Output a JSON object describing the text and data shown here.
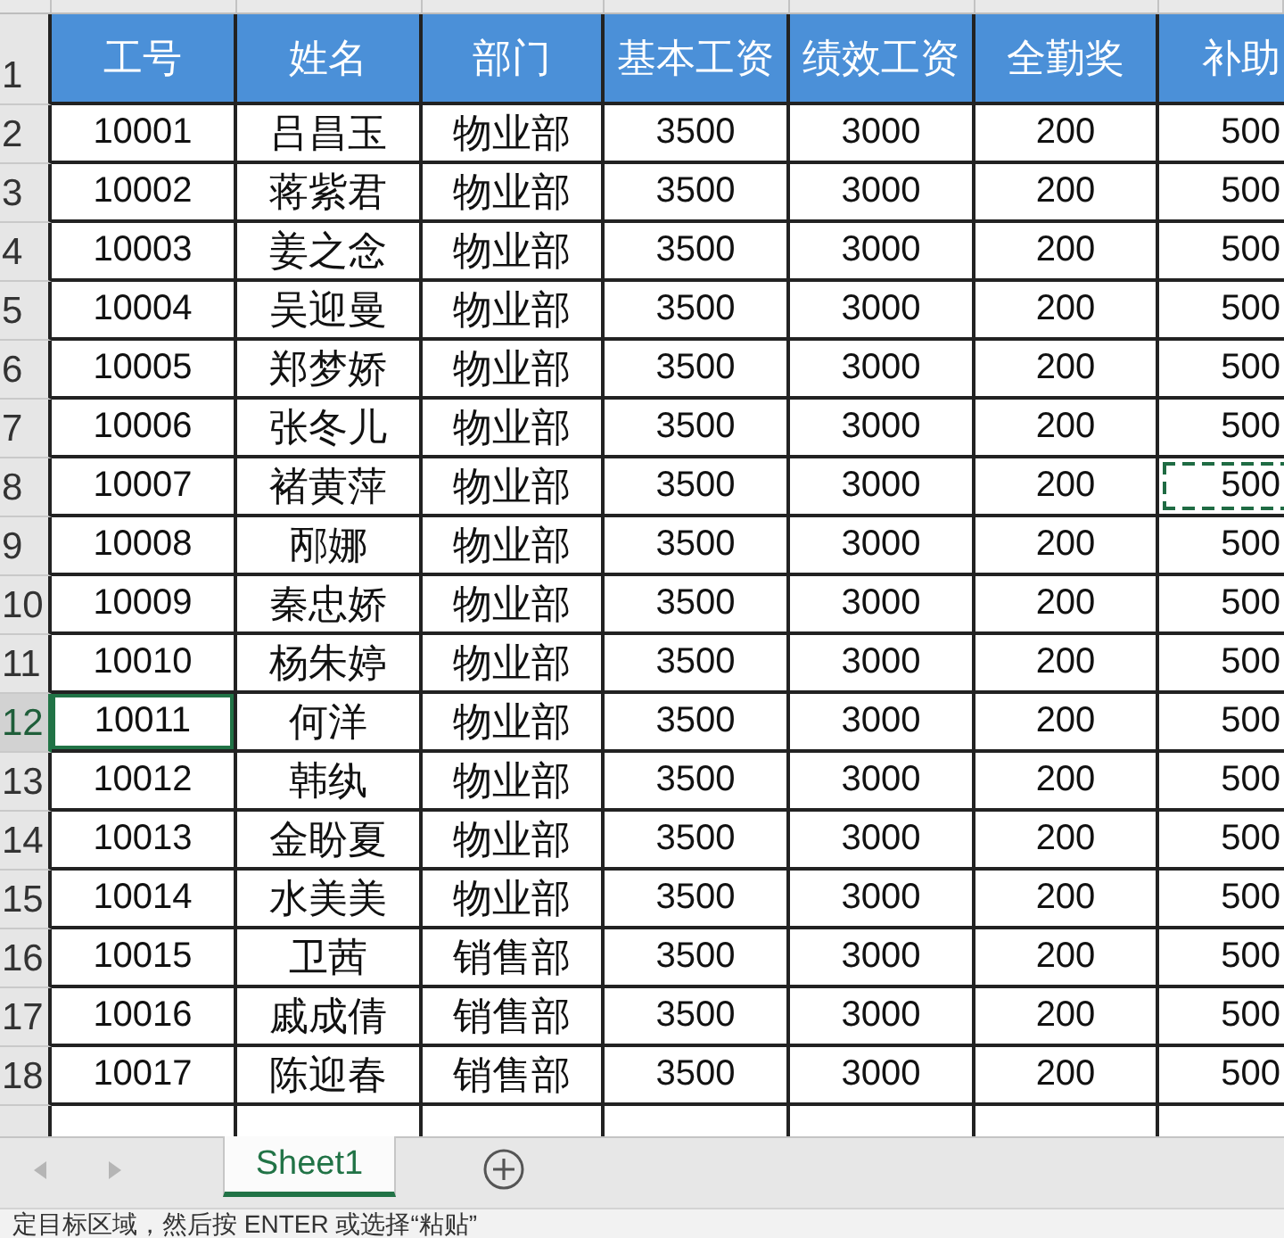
{
  "sheet": {
    "header_row_number": "1",
    "columns": [
      "工号",
      "姓名",
      "部门",
      "基本工资",
      "绩效工资",
      "全勤奖",
      "补助"
    ],
    "rows": [
      {
        "number": "2",
        "selected": false,
        "copied": false,
        "cells": [
          "10001",
          "吕昌玉",
          "物业部",
          "3500",
          "3000",
          "200",
          "500"
        ]
      },
      {
        "number": "3",
        "selected": false,
        "copied": false,
        "cells": [
          "10002",
          "蒋紫君",
          "物业部",
          "3500",
          "3000",
          "200",
          "500"
        ]
      },
      {
        "number": "4",
        "selected": false,
        "copied": false,
        "cells": [
          "10003",
          "姜之念",
          "物业部",
          "3500",
          "3000",
          "200",
          "500"
        ]
      },
      {
        "number": "5",
        "selected": false,
        "copied": false,
        "cells": [
          "10004",
          "吴迎曼",
          "物业部",
          "3500",
          "3000",
          "200",
          "500"
        ]
      },
      {
        "number": "6",
        "selected": false,
        "copied": false,
        "cells": [
          "10005",
          "郑梦娇",
          "物业部",
          "3500",
          "3000",
          "200",
          "500"
        ]
      },
      {
        "number": "7",
        "selected": false,
        "copied": false,
        "cells": [
          "10006",
          "张冬儿",
          "物业部",
          "3500",
          "3000",
          "200",
          "500"
        ]
      },
      {
        "number": "8",
        "selected": false,
        "copied": true,
        "cells": [
          "10007",
          "褚黄萍",
          "物业部",
          "3500",
          "3000",
          "200",
          "500"
        ]
      },
      {
        "number": "9",
        "selected": false,
        "copied": false,
        "cells": [
          "10008",
          "邴娜",
          "物业部",
          "3500",
          "3000",
          "200",
          "500"
        ]
      },
      {
        "number": "10",
        "selected": false,
        "copied": false,
        "cells": [
          "10009",
          "秦忠娇",
          "物业部",
          "3500",
          "3000",
          "200",
          "500"
        ]
      },
      {
        "number": "11",
        "selected": false,
        "copied": false,
        "cells": [
          "10010",
          "杨朱婷",
          "物业部",
          "3500",
          "3000",
          "200",
          "500"
        ]
      },
      {
        "number": "12",
        "selected": true,
        "copied": false,
        "cells": [
          "10011",
          "何洋",
          "物业部",
          "3500",
          "3000",
          "200",
          "500"
        ]
      },
      {
        "number": "13",
        "selected": false,
        "copied": false,
        "cells": [
          "10012",
          "韩纨",
          "物业部",
          "3500",
          "3000",
          "200",
          "500"
        ]
      },
      {
        "number": "14",
        "selected": false,
        "copied": false,
        "cells": [
          "10013",
          "金盼夏",
          "物业部",
          "3500",
          "3000",
          "200",
          "500"
        ]
      },
      {
        "number": "15",
        "selected": false,
        "copied": false,
        "cells": [
          "10014",
          "水美美",
          "物业部",
          "3500",
          "3000",
          "200",
          "500"
        ]
      },
      {
        "number": "16",
        "selected": false,
        "copied": false,
        "cells": [
          "10015",
          "卫茜",
          "销售部",
          "3500",
          "3000",
          "200",
          "500"
        ]
      },
      {
        "number": "17",
        "selected": false,
        "copied": false,
        "cells": [
          "10016",
          "戚成倩",
          "销售部",
          "3500",
          "3000",
          "200",
          "500"
        ]
      },
      {
        "number": "18",
        "selected": false,
        "copied": false,
        "cells": [
          "10017",
          "陈迎春",
          "销售部",
          "3500",
          "3000",
          "200",
          "500"
        ]
      }
    ]
  },
  "sheet_tabs": [
    {
      "label": "Sheet1",
      "selected": true
    }
  ],
  "status_bar": {
    "text": "定目标区域，然后按 ENTER 或选择“粘贴”"
  }
}
